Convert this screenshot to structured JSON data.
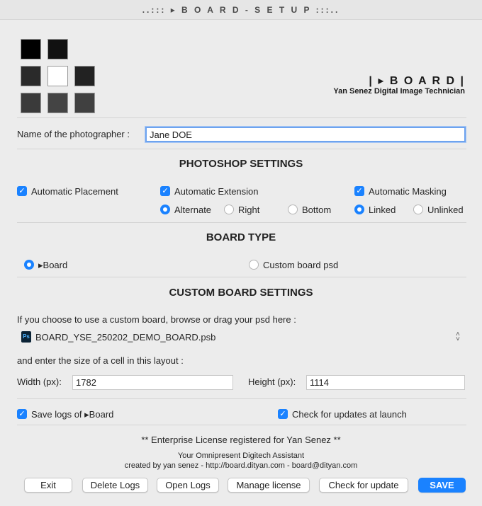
{
  "window": {
    "title": "..::: ▸ B O A R D - S E T U P :::.."
  },
  "logo": {
    "squares": [
      "#000000",
      "#111111",
      "#2a2a2a",
      "#ffffff",
      "#222222",
      "#3a3a3a",
      "#444444",
      "#404040"
    ],
    "brand": "| ▸ B O A R D |",
    "tagline": "Yan Senez Digital Image Technician"
  },
  "photographer": {
    "label": "Name of the photographer :",
    "value": "Jane DOE"
  },
  "photoshop": {
    "title": "PHOTOSHOP SETTINGS",
    "auto_placement": "Automatic Placement",
    "auto_extension": "Automatic Extension",
    "auto_masking": "Automatic Masking",
    "ext_alternate": "Alternate",
    "ext_right": "Right",
    "ext_bottom": "Bottom",
    "mask_linked": "Linked",
    "mask_unlinked": "Unlinked"
  },
  "board_type": {
    "title": "BOARD TYPE",
    "board": "▸Board",
    "custom": "Custom board psd"
  },
  "custom_board": {
    "title": "CUSTOM BOARD SETTINGS",
    "browse_text": "If you choose to use a custom board, browse or drag your psd here :",
    "file_icon": "Ps",
    "file_name": "BOARD_YSE_250202_DEMO_BOARD.psb",
    "size_text": "and enter the size of a cell in this layout :",
    "width_label": "Width (px):",
    "width_value": "1782",
    "height_label": "Height (px):",
    "height_value": "1114"
  },
  "options": {
    "save_logs": "Save logs of ▸Board",
    "check_updates": "Check for updates at launch"
  },
  "footer": {
    "license": "** Enterprise License registered for Yan Senez **",
    "assistant": "Your Omnipresent Digitech Assistant",
    "credits": "created by yan senez - http://board.dityan.com - board@dityan.com"
  },
  "buttons": {
    "exit": "Exit",
    "delete_logs": "Delete Logs",
    "open_logs": "Open Logs",
    "manage_license": "Manage license",
    "check_update": "Check for update",
    "save": "SAVE"
  }
}
